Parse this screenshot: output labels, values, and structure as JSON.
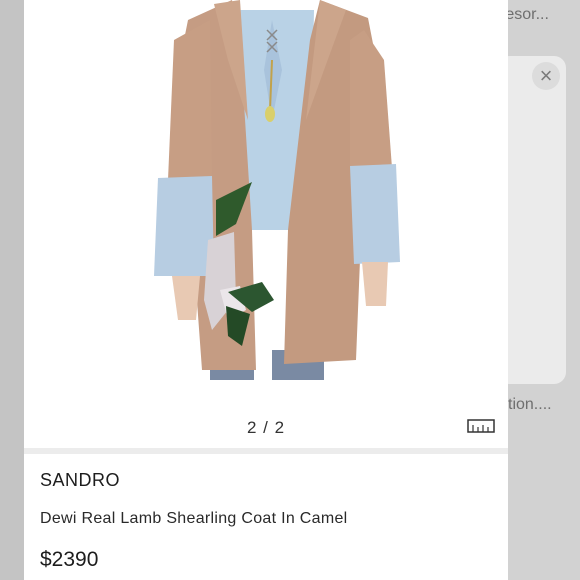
{
  "background": {
    "top_text": "resor...",
    "mid_text": "ction....",
    "close_icon": "close-icon"
  },
  "gallery": {
    "counter": "2 / 2",
    "size_icon": "ruler-icon"
  },
  "product": {
    "brand": "SANDRO",
    "title": "Dewi Real Lamb Shearling Coat In Camel",
    "price": "$2390"
  },
  "colors": {
    "camel": "#c49a82",
    "sky": "#b5cbe0",
    "leaf": "#2f5a2c"
  }
}
